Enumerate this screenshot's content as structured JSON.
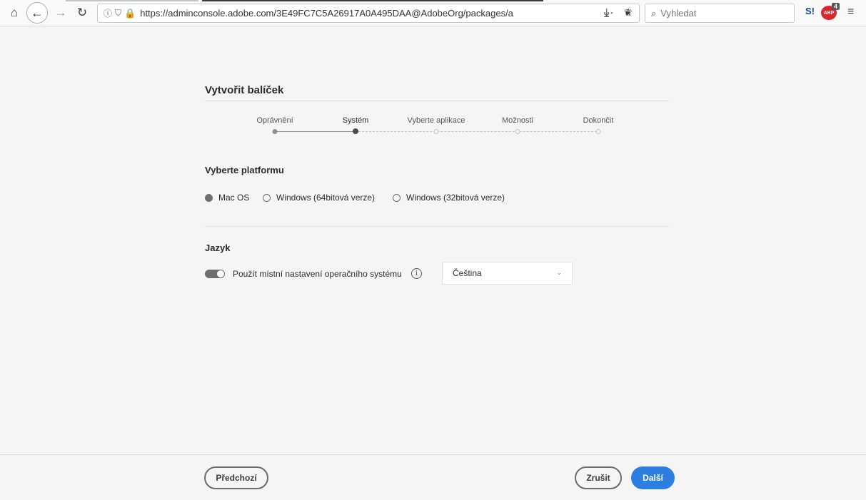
{
  "browser": {
    "url": "https://adminconsole.adobe.com/3E49FC7C5A26917A0A495DAA@AdobeOrg/packages/a",
    "search_placeholder": "Vyhledat",
    "icons": {
      "home": "⌂",
      "back": "←",
      "forward": "→",
      "reload": "↻",
      "info": "ⓘ",
      "shield": "⛉",
      "lock": "🔒",
      "more": "···",
      "bookmark": "☆",
      "download": "⤓",
      "pocket": "❦",
      "search": "⌕",
      "menu": "≡"
    },
    "ext_s_label": "S!",
    "ext_abp_label": "ABP",
    "ext_abp_count": "4"
  },
  "page": {
    "title": "Vytvořit balíček",
    "steps": [
      {
        "label": "Oprávnění",
        "state": "done"
      },
      {
        "label": "Systém",
        "state": "current"
      },
      {
        "label": "Vyberte aplikace",
        "state": "todo"
      },
      {
        "label": "Možnosti",
        "state": "todo"
      },
      {
        "label": "Dokončit",
        "state": "todo"
      }
    ],
    "platform": {
      "heading": "Vyberte platformu",
      "options": [
        {
          "label": "Mac OS",
          "checked": true
        },
        {
          "label": "Windows (64bitová verze)",
          "checked": false
        },
        {
          "label": "Windows (32bitová verze)",
          "checked": false
        }
      ]
    },
    "language": {
      "heading": "Jazyk",
      "toggle_label": "Použít místní nastavení operačního systému",
      "toggle_on": true,
      "info_glyph": "i",
      "selected": "Čeština",
      "chevron": "⌄"
    }
  },
  "footer": {
    "prev_label": "Předchozí",
    "cancel_label": "Zrušit",
    "next_label": "Další"
  },
  "colors": {
    "primary": "#2c7fe1",
    "background": "#f5f5f5"
  }
}
